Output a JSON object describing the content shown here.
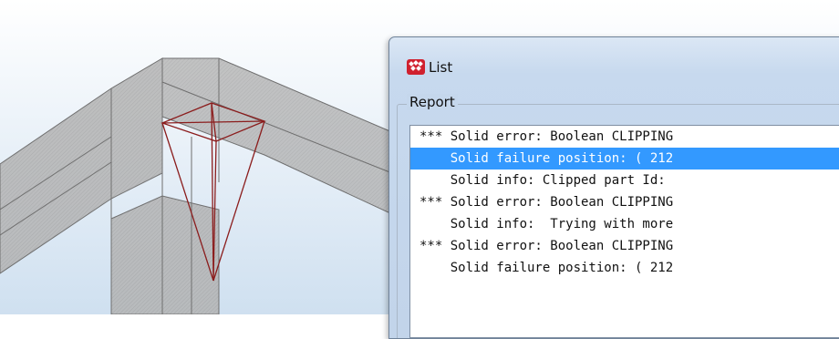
{
  "dialog": {
    "title": "List",
    "group_label": "Report",
    "report_lines": [
      {
        "text": "*** Solid error: Boolean CLIPPING",
        "selected": false
      },
      {
        "text": "    Solid failure position: ( 212",
        "selected": true
      },
      {
        "text": "    Solid info: Clipped part Id: ",
        "selected": false
      },
      {
        "text": "*** Solid error: Boolean CLIPPING",
        "selected": false
      },
      {
        "text": "    Solid info:  Trying with more",
        "selected": false
      },
      {
        "text": "*** Solid error: Boolean CLIPPING",
        "selected": false
      },
      {
        "text": "    Solid failure position: ( 212",
        "selected": false
      }
    ]
  },
  "icons": {
    "app_icon": "tekla-structures-icon"
  },
  "colors": {
    "viewport_background_top": "#ffffff",
    "viewport_background_bottom": "#cfe0f0",
    "beam_fill": "#a6a6a6",
    "beam_edge": "#6f6f6f",
    "cut_object": "#8b1d1d",
    "selection": "#3399ff"
  }
}
